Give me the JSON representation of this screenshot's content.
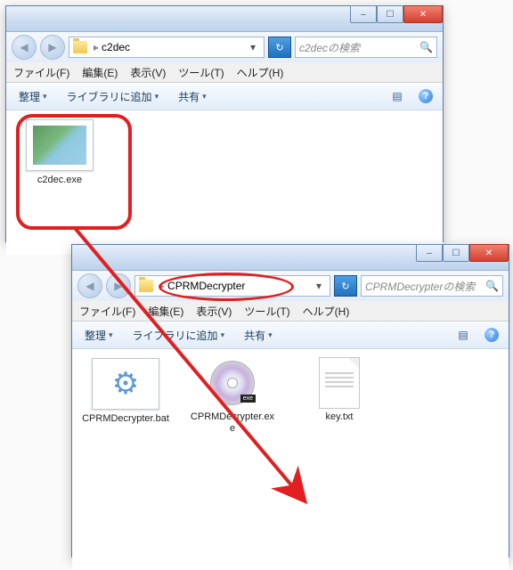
{
  "window1": {
    "address_path": "c2dec",
    "search_placeholder": "c2decの検索",
    "files": {
      "f1": "c2dec.exe"
    }
  },
  "window2": {
    "address_path": "CPRMDecrypter",
    "search_placeholder": "CPRMDecrypterの検索",
    "files": {
      "f1": "CPRMDecrypter.bat",
      "f2": "CPRMDecrypter.exe",
      "f3": "key.txt"
    }
  },
  "menus": {
    "file": "ファイル(F)",
    "edit": "編集(E)",
    "view": "表示(V)",
    "tools": "ツール(T)",
    "help": "ヘルプ(H)"
  },
  "toolbar": {
    "organize": "整理",
    "addlib": "ライブラリに追加",
    "share": "共有"
  },
  "glyphs": {
    "back": "◀",
    "fwd": "▶",
    "sep": "▸",
    "dd": "▾",
    "refresh": "↻",
    "search": "🔍",
    "min": "–",
    "max": "☐",
    "close": "✕",
    "view": "▤",
    "help": "?"
  }
}
